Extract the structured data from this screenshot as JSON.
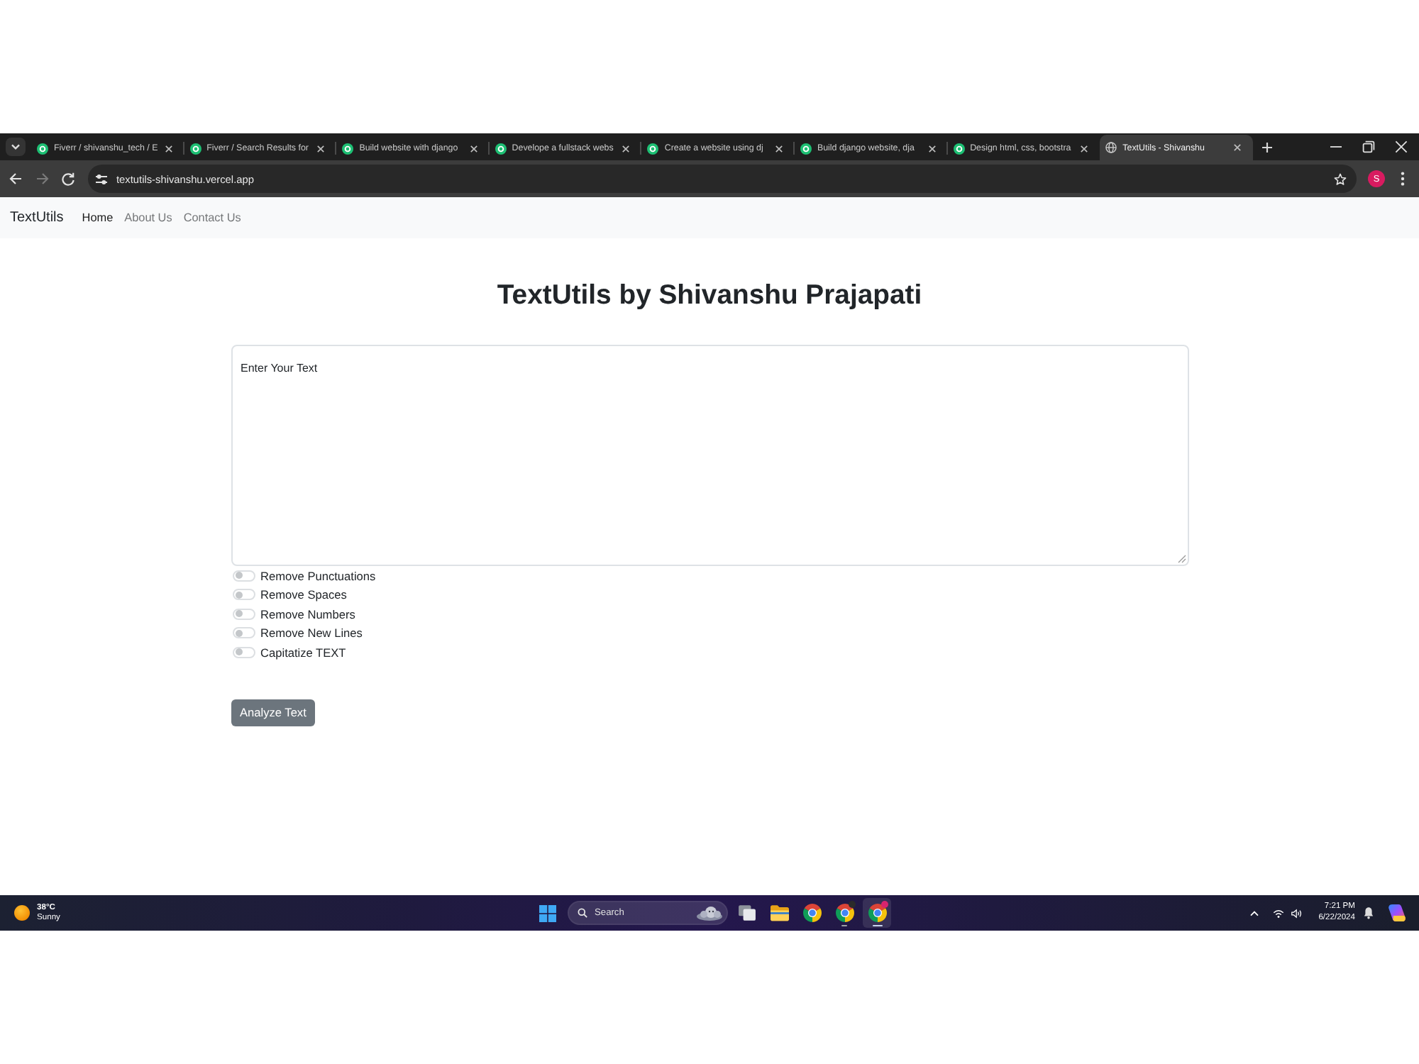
{
  "browser": {
    "tabs": [
      {
        "title": "Fiverr / shivanshu_tech / E",
        "kind": "marketplace",
        "selected": false
      },
      {
        "title": "Fiverr / Search Results for",
        "kind": "marketplace",
        "selected": false
      },
      {
        "title": "Build website with django",
        "kind": "marketplace",
        "selected": false
      },
      {
        "title": "Develope a fullstack webs",
        "kind": "marketplace",
        "selected": false
      },
      {
        "title": "Create a website using dj",
        "kind": "marketplace",
        "selected": false
      },
      {
        "title": "Build django website, dja",
        "kind": "marketplace",
        "selected": false
      },
      {
        "title": "Design html, css, bootstra",
        "kind": "marketplace",
        "selected": false
      },
      {
        "title": "TextUtils - Shivanshu",
        "kind": "site",
        "selected": true
      }
    ],
    "address": "textutils-shivanshu.vercel.app",
    "profile_initial": "S"
  },
  "navbar": {
    "brand": "TextUtils",
    "links": [
      {
        "label": "Home",
        "selected": true
      },
      {
        "label": "About Us",
        "selected": false
      },
      {
        "label": "Contact Us",
        "selected": false
      }
    ]
  },
  "heading": "TextUtils by Shivanshu Prajapati",
  "text_area": {
    "value": "Enter Your Text"
  },
  "switches": [
    {
      "label": "Remove Punctuations",
      "on": false
    },
    {
      "label": "Remove Spaces",
      "on": false
    },
    {
      "label": "Remove Numbers",
      "on": false
    },
    {
      "label": "Remove New Lines",
      "on": false
    },
    {
      "label": "Capitatize TEXT",
      "on": false
    }
  ],
  "analyze_button": "Analyze Text",
  "taskbar": {
    "weather": {
      "temperature": "38°C",
      "condition": "Sunny"
    },
    "search": {
      "placeholder": "Search"
    },
    "apps": [
      {
        "kind": "task-view",
        "running": false,
        "selected": false
      },
      {
        "kind": "folder",
        "running": false,
        "selected": false
      },
      {
        "kind": "browser",
        "running": false,
        "selected": false
      },
      {
        "kind": "browser",
        "running": true,
        "selected": false,
        "badge": {
          "color": "#2b2b2b"
        }
      },
      {
        "kind": "browser",
        "running": true,
        "selected": true,
        "badge": {
          "color": "#d6246e"
        }
      }
    ],
    "time": "7:21 PM",
    "date": "6/22/2024"
  }
}
